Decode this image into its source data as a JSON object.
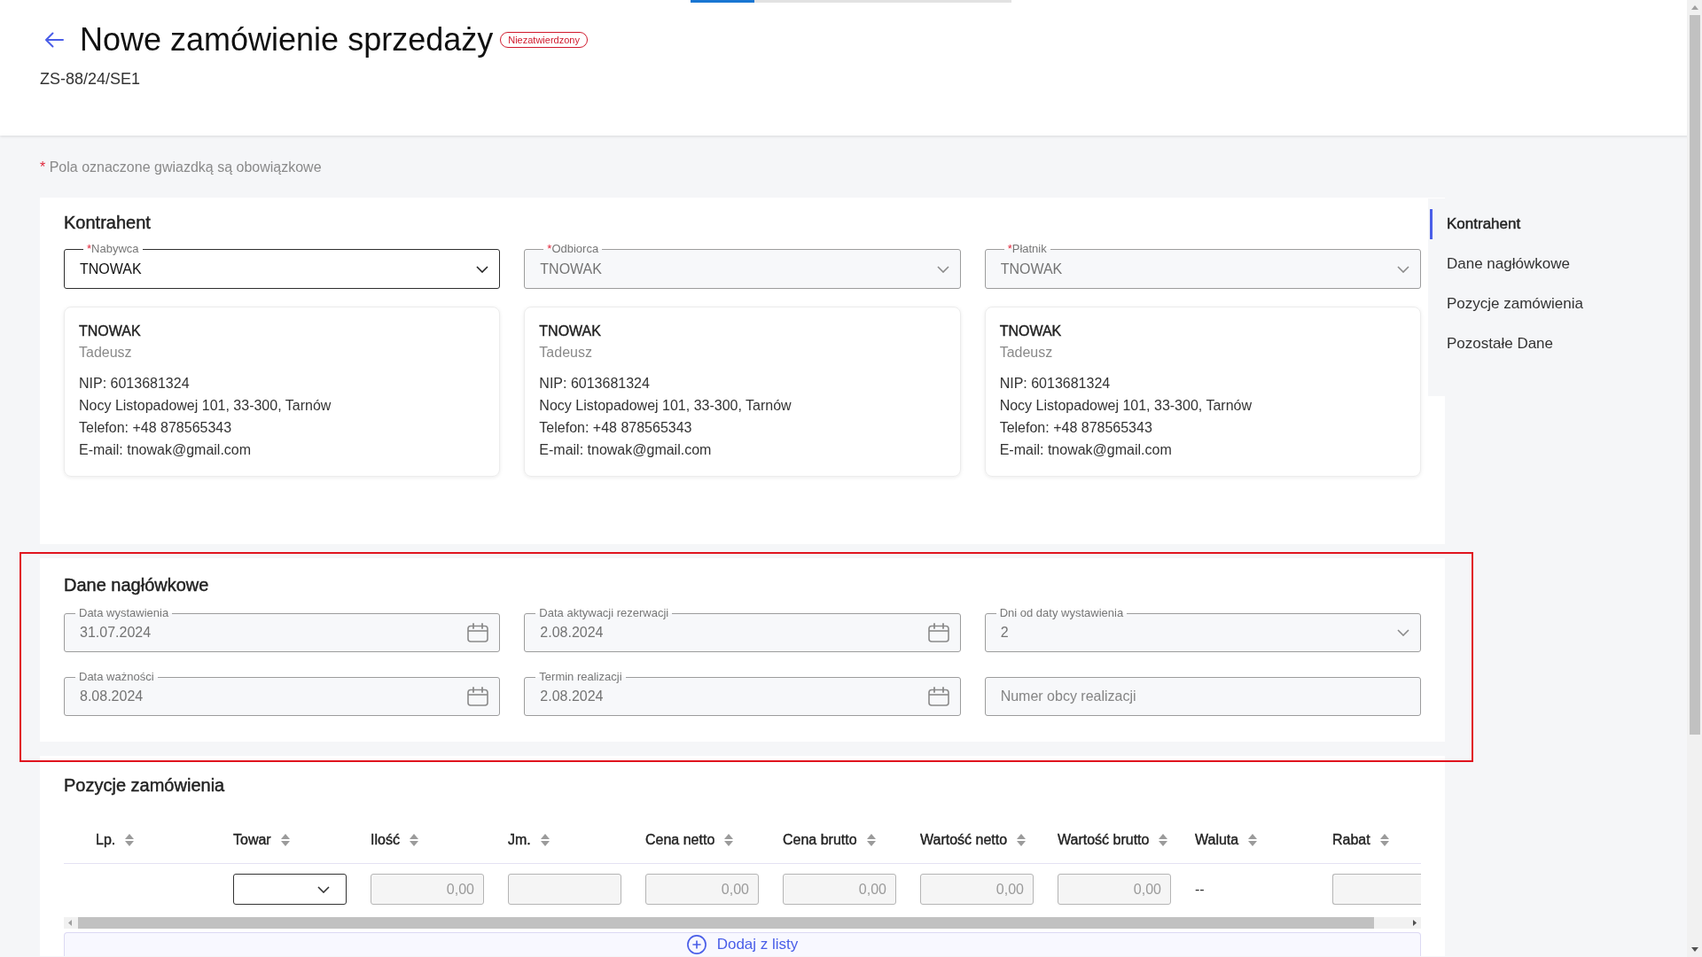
{
  "top_progress": {
    "level": 0.2
  },
  "header": {
    "title": "Nowe zamówienie sprzedaży",
    "status": "Niezatwierdzony",
    "number": "ZS-88/24/SE1"
  },
  "note": {
    "mark": "*",
    "text": "Pola oznaczone gwiazdką są obowiązkowe"
  },
  "contractor": {
    "title": "Kontrahent",
    "parties": [
      {
        "required_mark": "*",
        "label": "Nabywca",
        "value": "TNOWAK",
        "disabled": false,
        "card": {
          "code": "TNOWAK",
          "name": "Tadeusz",
          "lines": [
            "NIP: 6013681324",
            "Nocy Listopadowej 101, 33-300, Tarnów",
            "Telefon: +48 878565343",
            "E-mail: tnowak@gmail.com"
          ]
        }
      },
      {
        "required_mark": "*",
        "label": "Odbiorca",
        "value": "TNOWAK",
        "disabled": true,
        "card": {
          "code": "TNOWAK",
          "name": "Tadeusz",
          "lines": [
            "NIP: 6013681324",
            "Nocy Listopadowej 101, 33-300, Tarnów",
            "Telefon: +48 878565343",
            "E-mail: tnowak@gmail.com"
          ]
        }
      },
      {
        "required_mark": "*",
        "label": "Płatnik",
        "value": "TNOWAK",
        "disabled": true,
        "card": {
          "code": "TNOWAK",
          "name": "Tadeusz",
          "lines": [
            "NIP: 6013681324",
            "Nocy Listopadowej 101, 33-300, Tarnów",
            "Telefon: +48 878565343",
            "E-mail: tnowak@gmail.com"
          ]
        }
      }
    ]
  },
  "section_nav": [
    {
      "label": "Kontrahent",
      "selected": true
    },
    {
      "label": "Dane nagłówkowe",
      "selected": false
    },
    {
      "label": "Pozycje zamówienia",
      "selected": false
    },
    {
      "label": "Pozostałe Dane",
      "selected": false
    }
  ],
  "header_data": {
    "title": "Dane nagłówkowe",
    "highlighted": true,
    "fields": [
      {
        "kind": "date",
        "label": "Data wystawienia",
        "value": "31.07.2024"
      },
      {
        "kind": "date",
        "label": "Data aktywacji rezerwacji",
        "value": "2.08.2024"
      },
      {
        "kind": "select",
        "label": "Dni od daty wystawienia",
        "value": "2"
      },
      {
        "kind": "date",
        "label": "Data ważności",
        "value": "8.08.2024"
      },
      {
        "kind": "date",
        "label": "Termin realizacji",
        "value": "2.08.2024"
      },
      {
        "kind": "text",
        "placeholder": "Numer obcy realizacji"
      }
    ]
  },
  "items": {
    "title": "Pozycje zamówienia",
    "columns": [
      "Lp.",
      "Towar",
      "Ilość",
      "Jm.",
      "Cena netto",
      "Cena brutto",
      "Wartość netto",
      "Wartość brutto",
      "Waluta",
      "Rabat"
    ],
    "rows": [
      {
        "cells": [
          {
            "kind": "blank"
          },
          {
            "kind": "select"
          },
          {
            "kind": "input",
            "value": "0,00"
          },
          {
            "kind": "input"
          },
          {
            "kind": "input",
            "value": "0,00"
          },
          {
            "kind": "input",
            "value": "0,00"
          },
          {
            "kind": "input",
            "value": "0,00"
          },
          {
            "kind": "input",
            "value": "0,00"
          },
          {
            "kind": "text",
            "value": "--"
          },
          {
            "kind": "input"
          }
        ]
      }
    ],
    "add_label": "Dodaj z listy"
  }
}
